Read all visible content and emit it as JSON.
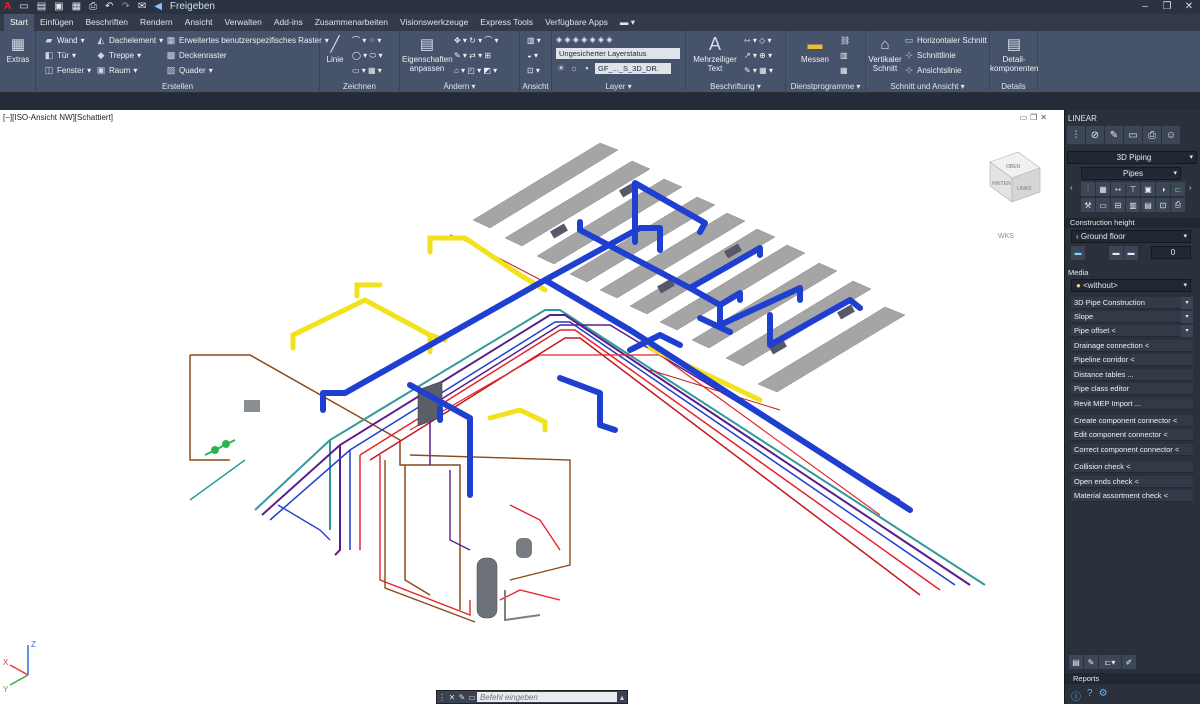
{
  "qat": {
    "share": "Freigeben"
  },
  "tabs": [
    "Start",
    "Einfügen",
    "Beschriften",
    "Rendern",
    "Ansicht",
    "Verwalten",
    "Add-ins",
    "Zusammenarbeiten",
    "Visionswerkzeuge",
    "Express Tools",
    "Verfügbare Apps"
  ],
  "ribbon": {
    "extras": "Extras",
    "create": {
      "wand": "Wand",
      "tuer": "Tür",
      "fenster": "Fenster",
      "dachelement": "Dachelement",
      "treppe": "Treppe",
      "raum": "Raum",
      "raster": "Erweitertes benutzerspezifisches Raster",
      "deckenraster": "Deckenraster",
      "quader": "Quader",
      "title": "Erstellen"
    },
    "draw": {
      "linie": "Linie",
      "title": "Zeichnen"
    },
    "modify": {
      "props_1": "Eigenschaften",
      "props_2": "anpassen",
      "title": "Ändern"
    },
    "view": {
      "title": "Ansicht"
    },
    "layer": {
      "status": "Ungesicherter Layerstatus",
      "current": "GF_..._S_3D_DR.",
      "title": "Layer"
    },
    "annot": {
      "mtext_1": "Mehrzeiliger",
      "mtext_2": "Text",
      "title": "Beschriftung"
    },
    "util": {
      "messen": "Messen",
      "title": "Dienstprogramme"
    },
    "section": {
      "vs_1": "Vertikaler",
      "vs_2": "Schnitt",
      "hs": "Horizontaler Schnitt",
      "schnittlinie": "Schnittlinie",
      "ansichtslinie": "Ansichtslinie",
      "title": "Schnitt und Ansicht"
    },
    "details": {
      "comp_1": "Detail-",
      "comp_2": "komponenten",
      "title": "Details"
    }
  },
  "viewport": {
    "label": "[−][ISO-Ansicht NW][Schattiert]",
    "viewcube_top": "OBEN",
    "viewcube_front": "HINTEN",
    "viewcube_side": "LINKS",
    "wcs": "WKS",
    "axis_z": "Z",
    "axis_x": "X",
    "axis_y": "Y"
  },
  "commandline": {
    "placeholder": "Befehl eingeben"
  },
  "panel": {
    "title": "LINEAR",
    "discipline": "3D Piping",
    "category": "Pipes",
    "construction_height": "Construction height",
    "floor": "Ground floor",
    "floor_value": "0",
    "media_label": "Media",
    "media_value": "<without>",
    "commands": [
      "3D Pipe Construction",
      "Slope",
      "Pipe offset <",
      "Drainage connection <",
      "Pipeline corridor <",
      "Distance tables ...",
      "Pipe class editor",
      "Revit MEP Import ...",
      "Create component connector <",
      "Edit component connector <",
      "Correct component connector <",
      "Collision check <",
      "Open ends check <",
      "Material assortment check <"
    ],
    "reports": "Reports"
  },
  "colors": {
    "supply_red": "#e8232a",
    "return_blue": "#1f3fd0",
    "gas_yellow": "#f2e21c",
    "purple": "#5a1e8a",
    "teal": "#2f9a99",
    "brown": "#8a4a1a",
    "roof_grey": "#a8a8a8"
  }
}
